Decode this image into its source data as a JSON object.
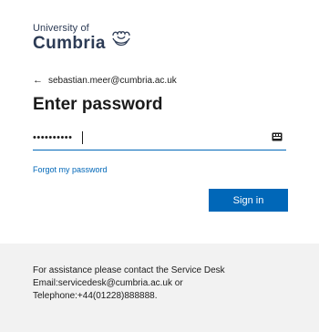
{
  "logo": {
    "line1": "University of",
    "line2": "Cumbria",
    "brand_color": "#2c3b55"
  },
  "identity": {
    "back_icon": "left-arrow-icon",
    "email": "sebastian.meer@cumbria.ac.uk"
  },
  "title": "Enter password",
  "password": {
    "value": "••••••••••",
    "icon": "keyboard-icon"
  },
  "links": {
    "forgot": "Forgot my password"
  },
  "buttons": {
    "signin": "Sign in"
  },
  "footer": {
    "line1": "For assistance please contact the Service Desk",
    "line2": "Email:servicedesk@cumbria.ac.uk or",
    "line3": "Telephone:+44(01228)888888."
  },
  "colors": {
    "accent": "#0067b8",
    "footer_bg": "#f2f2f2"
  }
}
